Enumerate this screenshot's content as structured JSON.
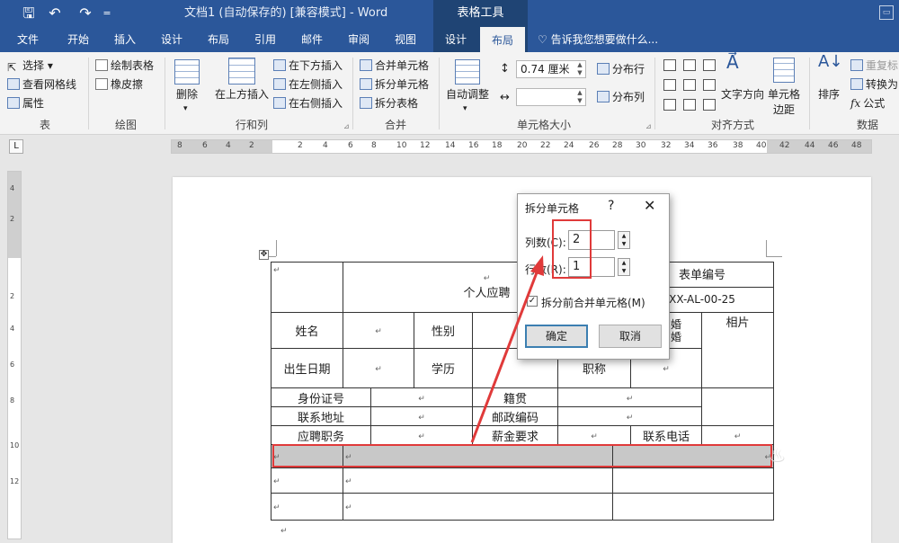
{
  "titlebar": {
    "save_icon": "save-icon",
    "undo_icon": "undo-icon",
    "redo_icon": "redo-icon",
    "qa_customize": "=",
    "doc_title": "文档1 (自动保存的) [兼容模式] - Word",
    "context_group": "表格工具",
    "restore_icon": "restore-icon"
  },
  "tabs": [
    "文件",
    "开始",
    "插入",
    "设计",
    "布局",
    "引用",
    "邮件",
    "审阅",
    "视图",
    "设计",
    "布局"
  ],
  "active_tab": "布局",
  "tellme": "告诉我您想要做什么...",
  "ribbon": {
    "table_group": {
      "label": "表",
      "select": "选择",
      "gridlines": "查看网格线",
      "properties": "属性"
    },
    "draw_group": {
      "label": "绘图",
      "draw_table": "绘制表格",
      "eraser": "橡皮擦"
    },
    "rows_cols_group": {
      "label": "行和列",
      "delete": "删除",
      "insert_above": "在上方插入",
      "insert_below": "在下方插入",
      "insert_left": "在左侧插入",
      "insert_right": "在右侧插入"
    },
    "merge_group": {
      "label": "合并",
      "merge_cells": "合并单元格",
      "split_cells": "拆分单元格",
      "split_table": "拆分表格"
    },
    "cell_size_group": {
      "label": "单元格大小",
      "autofit": "自动调整",
      "height_value": "0.74 厘米",
      "distribute_rows": "分布行",
      "distribute_cols": "分布列"
    },
    "alignment_group": {
      "label": "对齐方式",
      "text_direction": "文字方向",
      "cell_margins_1": "单元格",
      "cell_margins_2": "边距"
    },
    "data_group": {
      "label": "数据",
      "sort": "排序",
      "repeat_header": "重复标",
      "convert": "转换为",
      "formula": "公式"
    }
  },
  "ruler": {
    "h_labels": [
      "8",
      "6",
      "4",
      "2",
      "2",
      "4",
      "6",
      "8",
      "10",
      "12",
      "14",
      "16",
      "18",
      "20",
      "22",
      "24",
      "26",
      "28",
      "30",
      "32",
      "34",
      "36",
      "38",
      "40",
      "42",
      "44",
      "46",
      "48"
    ],
    "v_labels": [
      "4",
      "2",
      "2",
      "4",
      "6",
      "8",
      "10",
      "12"
    ]
  },
  "table": {
    "mark": "↵",
    "title": "个人应聘",
    "form_no_label": "表单编号",
    "form_no_value": "XX-AL-00-25",
    "name": "姓名",
    "gender": "性别",
    "marital_1": "婚",
    "marital_2": "婚",
    "photo": "相片",
    "birthdate": "出生日期",
    "education": "学历",
    "title_rank": "职称",
    "id_no": "身份证号",
    "native_place": "籍贯",
    "address": "联系地址",
    "postcode": "邮政编码",
    "position": "应聘职务",
    "salary": "薪金要求",
    "phone": "联系电话"
  },
  "dialog": {
    "title": "拆分单元格",
    "help": "?",
    "close": "✕",
    "cols_label": "列数(C):",
    "cols_value": "2",
    "rows_label": "行数(R):",
    "rows_value": "1",
    "merge_label": "拆分前合并单元格(M)",
    "ok": "确定",
    "cancel": "取消"
  },
  "colors": {
    "brand": "#2b579a",
    "highlight": "#e03a3a"
  }
}
